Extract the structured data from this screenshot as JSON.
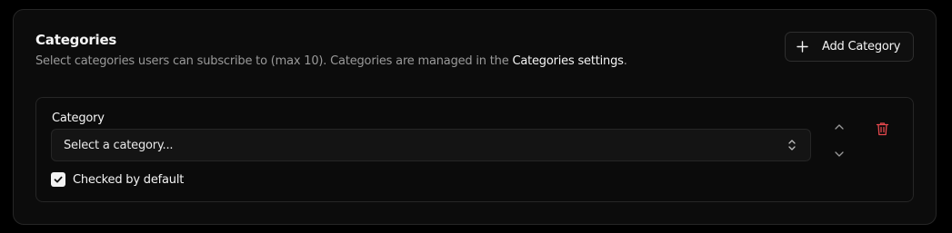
{
  "section": {
    "title": "Categories",
    "description_prefix": "Select categories users can subscribe to (max 10). Categories are managed in the ",
    "description_link": "Categories settings",
    "description_suffix": ".",
    "add_button_label": "Add Category"
  },
  "category_row": {
    "field_label": "Category",
    "select_value": "Select a category...",
    "checkbox_label": "Checked by default",
    "checkbox_checked": true
  },
  "icons": {
    "add": "plus-icon",
    "select": "chevrons-up-down-icon",
    "check": "check-icon",
    "move_up": "chevron-up-icon",
    "move_down": "chevron-down-icon",
    "delete": "trash-icon"
  },
  "colors": {
    "background": "#000000",
    "card": "#0c0c0c",
    "border": "#262626",
    "text": "#f5f5f5",
    "muted": "#9a9a9a",
    "danger": "#e5484d"
  }
}
